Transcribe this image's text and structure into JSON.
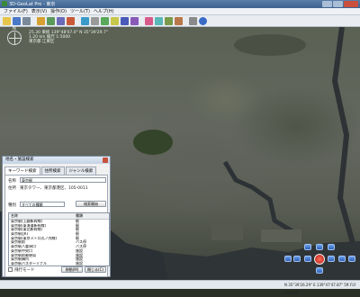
{
  "window": {
    "title": "3D-GeoLat Pro - 東京"
  },
  "menu": [
    "ファイル(F)",
    "表示(V)",
    "操作(O)",
    "ツール(T)",
    "ヘルプ(H)"
  ],
  "hud": {
    "line1": "25.30 東経 139°48'07.0\" N 35°39'29.7\"",
    "line2": "1.20 km 縮尺 1:5000",
    "line3": "東京都 江東区"
  },
  "compass": {
    "north": "N"
  },
  "dialog": {
    "title": "地名・施設検索",
    "tabs": [
      "キーワード検索",
      "住所検索",
      "ジャンル検索"
    ],
    "name_label": "名称",
    "name_value": "東京駅",
    "address_label": "住所",
    "address_value": "東京タワー、東京都港区、105-0011",
    "type_label": "種別",
    "type_value": "すべての種類",
    "search_button": "検索開始",
    "list_header": {
      "name": "名称",
      "kind": "種類"
    },
    "list_rows": [
      {
        "name": "東京駅(上越新幹線)",
        "kind": "駅"
      },
      {
        "name": "東京駅(東海道新幹線)",
        "kind": "駅"
      },
      {
        "name": "東京駅(東北新幹線)",
        "kind": "駅"
      },
      {
        "name": "東京駅(JR)",
        "kind": "駅"
      },
      {
        "name": "東京駅(東京メトロ丸ノ内線)",
        "kind": "駅"
      },
      {
        "name": "東京駅前",
        "kind": "バス停"
      },
      {
        "name": "東京駅八重洲口",
        "kind": "バス停"
      },
      {
        "name": "東京駅中央口",
        "kind": "施設"
      },
      {
        "name": "東京駅前郵便局",
        "kind": "施設"
      },
      {
        "name": "東京駅構内",
        "kind": "施設"
      },
      {
        "name": "東京駅バスターミナル",
        "kind": "施設"
      }
    ],
    "checkbox_label": "飛行モード",
    "move_button": "移動(M)",
    "close_button": "閉じる(C)"
  },
  "status": {
    "coords": "N 35°39'26.29\"  E 139°47'47.87\"  5ft  FLY  MIDDLE"
  },
  "colors": {
    "accent": "#3d6190",
    "water": "#2b3034"
  }
}
